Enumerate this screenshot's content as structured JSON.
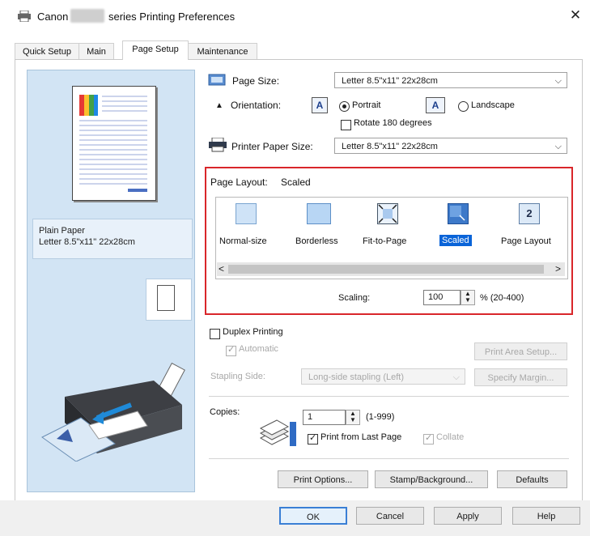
{
  "window": {
    "title_prefix": "Canon",
    "title_suffix": "series Printing Preferences",
    "close_glyph": "✕"
  },
  "tabs": [
    {
      "label": "Quick Setup"
    },
    {
      "label": "Main"
    },
    {
      "label": "Page Setup"
    },
    {
      "label": "Maintenance"
    }
  ],
  "preview": {
    "media_type": "Plain Paper",
    "paper_size": "Letter 8.5\"x11\" 22x28cm"
  },
  "page_size": {
    "label": "Page Size:",
    "value": "Letter 8.5\"x11\" 22x28cm"
  },
  "orientation": {
    "label": "Orientation:",
    "portrait": "Portrait",
    "landscape": "Landscape",
    "rotate": "Rotate 180 degrees",
    "selected": "portrait",
    "icon_glyph": "A"
  },
  "printer_paper_size": {
    "label": "Printer Paper Size:",
    "value": "Letter 8.5\"x11\" 22x28cm"
  },
  "page_layout": {
    "label": "Page Layout:",
    "current": "Scaled",
    "options": [
      {
        "label": "Normal-size"
      },
      {
        "label": "Borderless"
      },
      {
        "label": "Fit-to-Page"
      },
      {
        "label": "Scaled"
      },
      {
        "label": "Page Layout"
      }
    ],
    "page_layout_icon_glyph": "2",
    "scroll_left": "<",
    "scroll_right": ">"
  },
  "scaling": {
    "label": "Scaling:",
    "value": "100",
    "range": "% (20-400)"
  },
  "duplex": {
    "label": "Duplex Printing",
    "automatic": "Automatic",
    "print_area_setup": "Print Area Setup...",
    "stapling_side_label": "Stapling Side:",
    "stapling_side_value": "Long-side stapling (Left)",
    "specify_margin": "Specify Margin..."
  },
  "copies": {
    "label": "Copies:",
    "value": "1",
    "range": "(1-999)",
    "print_from_last": "Print from Last Page",
    "collate": "Collate"
  },
  "bottom_buttons": {
    "print_options": "Print Options...",
    "stamp_background": "Stamp/Background...",
    "defaults": "Defaults"
  },
  "dialog_buttons": {
    "ok": "OK",
    "cancel": "Cancel",
    "apply": "Apply",
    "help": "Help"
  },
  "colors": {
    "highlight_red": "#d9262a",
    "selected_blue": "#0a64d8",
    "preview_bg": "#d2e4f4"
  }
}
